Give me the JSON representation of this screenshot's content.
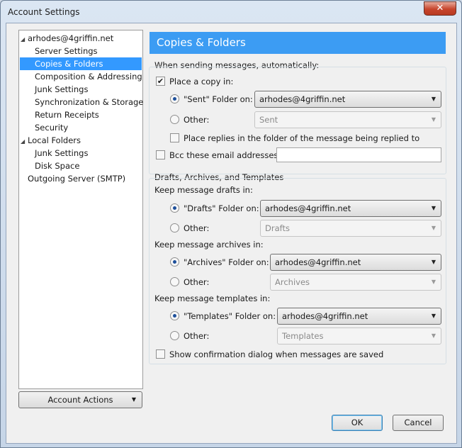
{
  "window": {
    "title": "Account Settings",
    "close_glyph": "✕"
  },
  "sidebar": {
    "items": [
      {
        "label": "arhodes@4griffin.net",
        "expandable": true
      },
      {
        "label": "Server Settings"
      },
      {
        "label": "Copies & Folders",
        "selected": true
      },
      {
        "label": "Composition & Addressing"
      },
      {
        "label": "Junk Settings"
      },
      {
        "label": "Synchronization & Storage"
      },
      {
        "label": "Return Receipts"
      },
      {
        "label": "Security"
      },
      {
        "label": "Local Folders",
        "expandable": true
      },
      {
        "label": "Junk Settings"
      },
      {
        "label": "Disk Space"
      },
      {
        "label": "Outgoing Server (SMTP)"
      }
    ],
    "account_actions_label": "Account Actions"
  },
  "panel": {
    "title": "Copies & Folders",
    "sending": {
      "group_label": "When sending messages, automatically:",
      "place_copy_label": "Place a copy in:",
      "place_copy_checked": true,
      "sent_folder_label": "\"Sent\" Folder on:",
      "sent_folder_value": "arhodes@4griffin.net",
      "other_label": "Other:",
      "other_value": "Sent",
      "place_replies_label": "Place replies in the folder of the message being replied to",
      "bcc_label": "Bcc these email addresses:",
      "bcc_value": ""
    },
    "drafts": {
      "group_label": "Drafts, Archives, and Templates",
      "drafts_keep_label": "Keep message drafts in:",
      "drafts_folder_label": "\"Drafts\" Folder on:",
      "drafts_folder_value": "arhodes@4griffin.net",
      "drafts_other_label": "Other:",
      "drafts_other_value": "Drafts",
      "archives_keep_label": "Keep message archives in:",
      "archives_folder_label": "\"Archives\" Folder on:",
      "archives_folder_value": "arhodes@4griffin.net",
      "archives_other_label": "Other:",
      "archives_other_value": "Archives",
      "templates_keep_label": "Keep message templates in:",
      "templates_folder_label": "\"Templates\" Folder on:",
      "templates_folder_value": "arhodes@4griffin.net",
      "templates_other_label": "Other:",
      "templates_other_value": "Templates",
      "confirm_label": "Show confirmation dialog when messages are saved"
    }
  },
  "buttons": {
    "ok": "OK",
    "cancel": "Cancel"
  },
  "colors": {
    "accent": "#3c9cf3",
    "selection": "#3399ff"
  }
}
